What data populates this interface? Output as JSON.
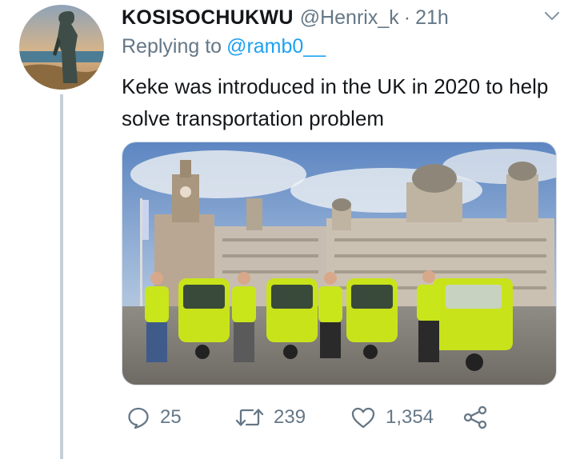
{
  "tweet": {
    "author": {
      "display_name": "KOSISOCHUKWU",
      "handle": "@Henrix_k",
      "avatar_icon": "statue-avatar"
    },
    "separator": "·",
    "time": "21h",
    "replying_to_label": "Replying to",
    "replying_to_handle": "@ramb0__",
    "text": "Keke was introduced in the UK in 2020 to help solve transportation problem",
    "media": {
      "type": "photo",
      "subject": "people standing beside yellow-green tuk-tuks in front of historic buildings"
    },
    "actions": {
      "reply_count": "25",
      "retweet_count": "239",
      "like_count": "1,354"
    }
  },
  "colors": {
    "text_primary": "#14171a",
    "text_secondary": "#657786",
    "link": "#1da1f2",
    "thread_line": "#c4cfd6"
  }
}
